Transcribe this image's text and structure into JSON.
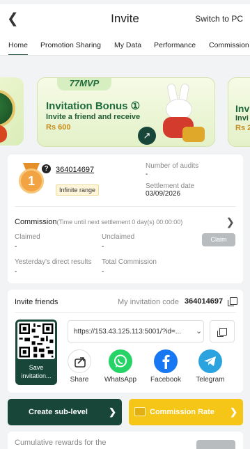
{
  "header": {
    "title": "Invite",
    "switch_label": "Switch to PC"
  },
  "tabs": [
    {
      "label": "Home",
      "active": true
    },
    {
      "label": "Promotion Sharing"
    },
    {
      "label": "My Data"
    },
    {
      "label": "Performance"
    },
    {
      "label": "Commission"
    }
  ],
  "banner": {
    "tag": "77MVP",
    "title": "Invitation Bonus ①",
    "subtitle": "Invite a friend and receive",
    "amount": "Rs 600",
    "next_title": "Inv",
    "next_subtitle": "Invi",
    "next_amount": "Rs 2"
  },
  "account": {
    "level_number": "1",
    "uid": "364014697",
    "range_badge": "Infinite range",
    "audits_label": "Number of audits",
    "audits_value": "-",
    "settlement_label": "Settlement date",
    "settlement_value": "03/09/2026"
  },
  "commission": {
    "title": "Commission",
    "hint": "(Time until next settlement  0 day(s) 00:00:00)",
    "claimed_label": "Claimed",
    "claimed_value": "-",
    "unclaimed_label": "Unclaimed",
    "unclaimed_value": "-",
    "claim_button": "Claim",
    "yesterday_label": "Yesterday's direct results",
    "yesterday_value": "-",
    "total_label": "Total Commission",
    "total_value": "-"
  },
  "invite": {
    "title": "Invite friends",
    "code_label": "My invitation code",
    "code_value": "364014697",
    "qr_label": "Save invitation...",
    "url": "https://153.43.125.113:5001/?id=...",
    "share": [
      {
        "label": "Share",
        "color": "#ffffff"
      },
      {
        "label": "WhatsApp",
        "color": "#25d366"
      },
      {
        "label": "Facebook",
        "color": "#1877f2"
      },
      {
        "label": "Telegram",
        "color": "#2aa3de"
      }
    ]
  },
  "actions": {
    "create_label": "Create sub-level",
    "rate_label": "Commission Rate"
  },
  "cumulative": {
    "text": "Cumulative rewards for the"
  },
  "colors": {
    "primary": "#18473a",
    "accent": "#f5c518",
    "disabled": "#b9bcbf"
  }
}
